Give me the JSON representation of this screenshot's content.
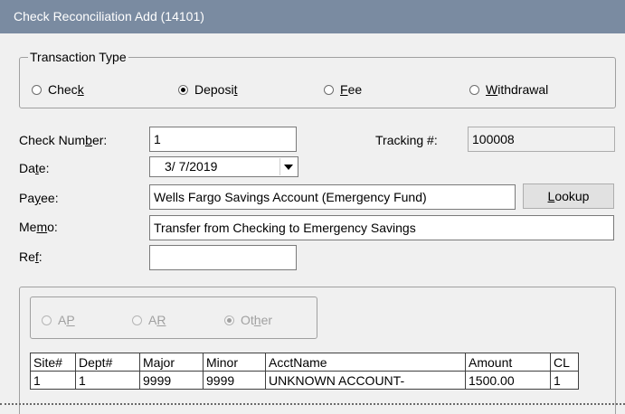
{
  "window": {
    "title": "Check Reconciliation Add (14101)"
  },
  "transaction_type": {
    "legend": "Transaction Type",
    "options": [
      {
        "label": "Check",
        "accel": "k",
        "selected": false
      },
      {
        "label": "Deposit",
        "accel": "t",
        "selected": true
      },
      {
        "label": "Fee",
        "accel": "F",
        "selected": false
      },
      {
        "label": "Withdrawal",
        "accel": "W",
        "selected": false
      }
    ]
  },
  "form": {
    "check_number": {
      "label": "Check Number:",
      "value": "1"
    },
    "tracking": {
      "label": "Tracking #:",
      "value": "100008"
    },
    "date": {
      "label": "Date:",
      "value": "3/ 7/2019"
    },
    "payee": {
      "label": "Payee:",
      "value": "Wells Fargo Savings Account (Emergency Fund)"
    },
    "lookup_button": "Lookup",
    "memo": {
      "label": "Memo:",
      "value": "Transfer from Checking to Emergency Savings"
    },
    "ref": {
      "label": "Ref:",
      "value": ""
    }
  },
  "account_type": {
    "options": [
      {
        "label": "AP",
        "selected": false
      },
      {
        "label": "AR",
        "selected": false
      },
      {
        "label": "Other",
        "selected": true
      }
    ]
  },
  "grid": {
    "columns": [
      "Site#",
      "Dept#",
      "Major",
      "Minor",
      "AcctName",
      "Amount",
      "CL"
    ],
    "rows": [
      [
        "1",
        "1",
        "9999",
        "9999",
        "UNKNOWN ACCOUNT-",
        "1500.00",
        "1"
      ]
    ]
  }
}
